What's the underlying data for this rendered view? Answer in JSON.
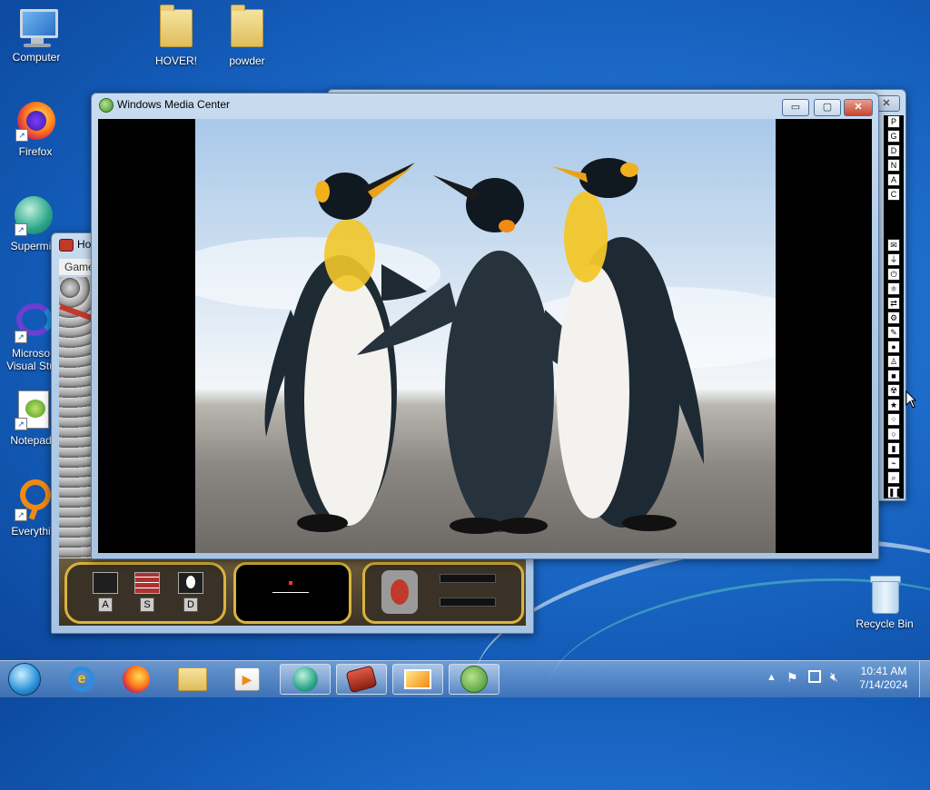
{
  "desktop": {
    "icons": [
      {
        "label": "Computer",
        "icon": "computer-icon"
      },
      {
        "label": "HOVER!",
        "icon": "folder-icon"
      },
      {
        "label": "powder",
        "icon": "folder-icon"
      },
      {
        "label": "Firefox",
        "icon": "firefox-icon"
      },
      {
        "label": "Supermi",
        "icon": "supermium-icon"
      },
      {
        "label": "Microso",
        "label2": "Visual Stu",
        "icon": "visual-studio-icon"
      },
      {
        "label": "Notepad",
        "icon": "notepad-icon"
      },
      {
        "label": "Everythi",
        "icon": "everything-icon"
      },
      {
        "label": "Recycle Bin",
        "icon": "recycle-bin-icon"
      }
    ]
  },
  "windows": {
    "media_center": {
      "title": "Windows Media Center",
      "controls": {
        "minimize": "▭",
        "maximize": "▢",
        "close": "✕"
      },
      "image": "penguins-photo"
    },
    "game": {
      "title_partial": "Ho",
      "menu_partial": "Game",
      "hud_keys": [
        "A",
        "S",
        "D"
      ]
    },
    "powder": {
      "close": "✕",
      "element_buttons": [
        "P",
        "G",
        "D",
        "N",
        "A",
        "C"
      ],
      "tool_icons": [
        "mail-icon",
        "plug-icon",
        "power-icon",
        "atom-icon",
        "flow-icon",
        "gear-icon",
        "pen-icon",
        "drop-icon",
        "person-icon",
        "square-icon",
        "radiation-icon",
        "star-icon",
        "dots-icon",
        "bulb-icon",
        "bookmark-icon",
        "brush-icon",
        "search-icon",
        "pause-icon"
      ]
    }
  },
  "taskbar": {
    "pinned": [
      "start-orb-icon",
      "internet-explorer-icon",
      "firefox-icon",
      "explorer-icon",
      "media-player-icon",
      "supermium-icon",
      "hover-game-icon",
      "powder-toy-icon",
      "media-center-icon"
    ],
    "time": "10:41 AM",
    "date": "7/14/2024"
  },
  "colors": {
    "desktop_bg": "#1f6fce",
    "aero_frame": "#b2cbe6",
    "close_red": "#c7452e"
  }
}
